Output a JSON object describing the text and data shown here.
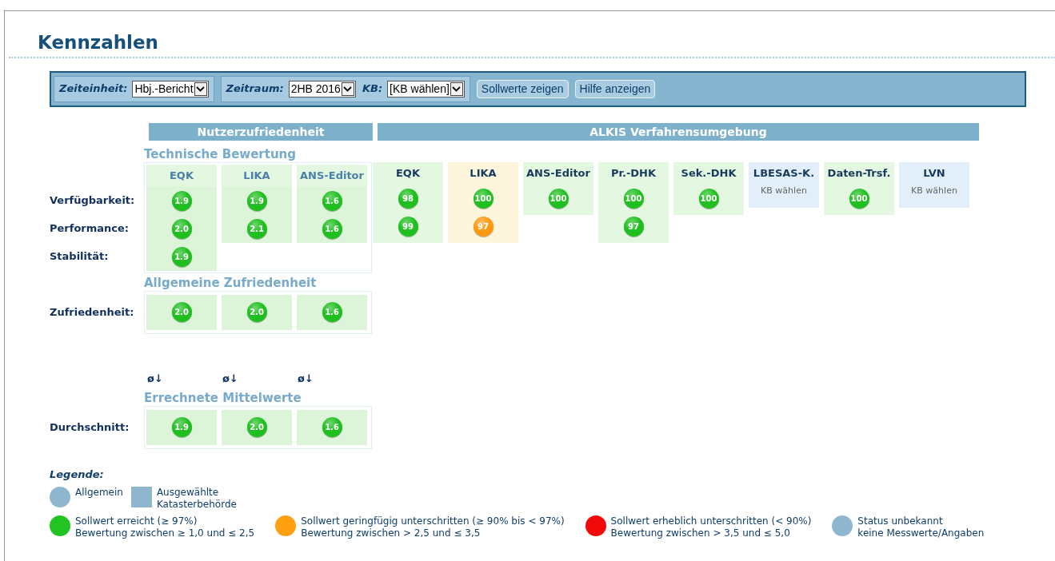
{
  "title": "Kennzahlen",
  "toolbar": {
    "field_groups": [
      [
        {
          "label": "Zeiteinheit:",
          "value": "Hbj.-Bericht"
        }
      ],
      [
        {
          "label": "Zeitraum:",
          "value": "2HB 2016"
        },
        {
          "label": "KB:",
          "value": "[KB wählen]"
        }
      ]
    ],
    "buttons": [
      "Sollwerte zeigen",
      "Hilfe anzeigen"
    ]
  },
  "user_satisfaction": {
    "header": "Nutzerzufriedenheit",
    "sections": [
      {
        "title": "Technische Bewertung",
        "columns": [
          "EQK",
          "LIKA",
          "ANS-Editor"
        ],
        "rows": [
          {
            "label": "Verfügbarkeit:",
            "cells": [
              {
                "value": "1.9",
                "color": "#1fbf1f"
              },
              {
                "value": "1.9",
                "color": "#1fbf1f"
              },
              {
                "value": "1.6",
                "color": "#1fbf1f"
              }
            ]
          },
          {
            "label": "Performance:",
            "cells": [
              {
                "value": "2.0",
                "color": "#1fbf1f"
              },
              {
                "value": "2.1",
                "color": "#1fbf1f"
              },
              {
                "value": "1.6",
                "color": "#1fbf1f"
              }
            ]
          },
          {
            "label": "Stabilität:",
            "cells": [
              {
                "value": "1.9",
                "color": "#1fbf1f"
              }
            ]
          }
        ]
      },
      {
        "title": "Allgemeine Zufriedenheit",
        "rows": [
          {
            "label": "Zufriedenheit:",
            "cells": [
              {
                "value": "2.0",
                "color": "#1fbf1f"
              },
              {
                "value": "2.0",
                "color": "#1fbf1f"
              },
              {
                "value": "1.6",
                "color": "#1fbf1f"
              }
            ]
          }
        ]
      },
      {
        "title": "Errechnete Mittelwerte",
        "marks": [
          "ø↓",
          "ø↓",
          "ø↓"
        ],
        "rows": [
          {
            "label": "Durchschnitt:",
            "cells": [
              {
                "value": "1.9",
                "color": "#1fbf1f"
              },
              {
                "value": "2.0",
                "color": "#1fbf1f"
              },
              {
                "value": "1.6",
                "color": "#1fbf1f"
              }
            ]
          }
        ]
      }
    ]
  },
  "procedure_environment": {
    "header": "ALKIS Verfahrensumgebung",
    "columns": [
      {
        "name": "EQK",
        "color": "#e4f8e1",
        "values": [
          {
            "value": "98",
            "color": "#1fbf1f"
          },
          {
            "value": "99",
            "color": "#1fbf1f"
          }
        ]
      },
      {
        "name": "LIKA",
        "color": "#fdf6dc",
        "values": [
          {
            "value": "100",
            "color": "#1fbf1f"
          },
          {
            "value": "97",
            "color": "#ff9a10"
          }
        ]
      },
      {
        "name": "ANS-Editor",
        "color": "#e4f8e1",
        "values": [
          {
            "value": "100",
            "color": "#1fbf1f"
          }
        ]
      },
      {
        "name": "Pr.-DHK",
        "color": "#e4f8e1",
        "values": [
          {
            "value": "100",
            "color": "#1fbf1f"
          },
          {
            "value": "97",
            "color": "#1fbf1f"
          }
        ]
      },
      {
        "name": "Sek.-DHK",
        "color": "#e4f8e1",
        "values": [
          {
            "value": "100",
            "color": "#1fbf1f"
          }
        ]
      },
      {
        "name": "LBESAS-K.",
        "color": "#e2eef9",
        "note": "KB wählen"
      },
      {
        "name": "Daten-Trsf.",
        "color": "#e4f8e1",
        "values": [
          {
            "value": "100",
            "color": "#1fbf1f"
          }
        ]
      },
      {
        "name": "LVN",
        "color": "#e2eef9",
        "note": "KB wählen"
      }
    ]
  },
  "legend": {
    "title": "Legende:",
    "general": [
      {
        "kind": "circle",
        "color": "#8fb6cf",
        "lines": [
          "Allgemein"
        ]
      },
      {
        "kind": "square",
        "color": "#8fb6cf",
        "lines": [
          "Ausgewählte",
          "Katasterbehörde"
        ]
      }
    ],
    "status": [
      {
        "kind": "circle",
        "color": "#22c322",
        "lines": [
          "Sollwert erreicht (≥ 97%)",
          "Bewertung zwischen ≥ 1,0 und ≤ 2,5"
        ]
      },
      {
        "kind": "circle",
        "color": "#ffa010",
        "lines": [
          "Sollwert geringfügig unterschritten (≥ 90% bis < 97%)",
          "Bewertung zwischen > 2,5 und ≤ 3,5"
        ]
      },
      {
        "kind": "circle",
        "color": "#f00a0a",
        "lines": [
          "Sollwert erheblich unterschritten (< 90%)",
          "Bewertung zwischen > 3,5 und ≤ 5,0"
        ]
      },
      {
        "kind": "circle",
        "color": "#8fb6cf",
        "lines": [
          "Status unbekannt",
          "keine Messwerte/Angaben"
        ]
      }
    ]
  }
}
